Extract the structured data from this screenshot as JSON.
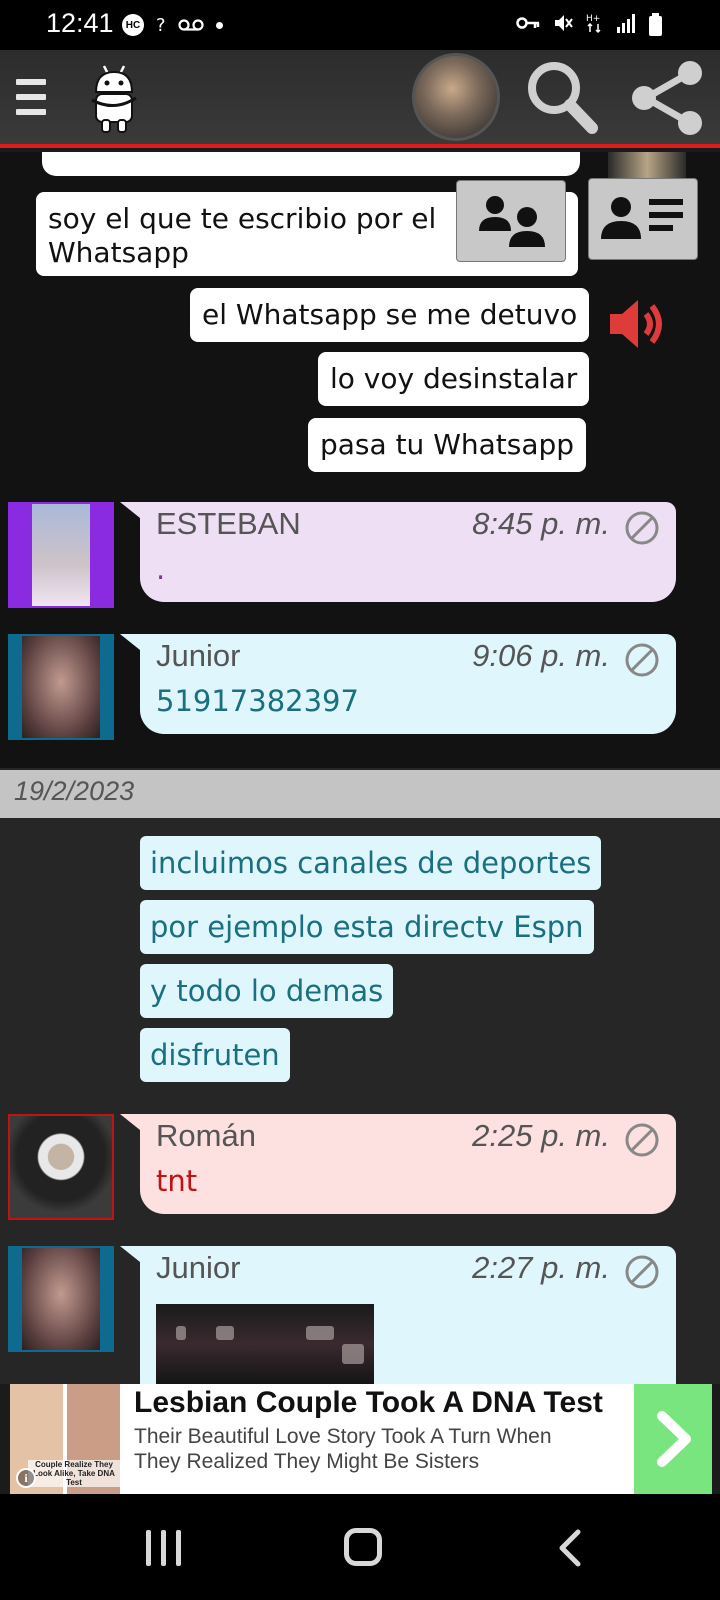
{
  "status_bar": {
    "time": "12:41",
    "hc_badge": "HC",
    "network_small": "?",
    "voicemail_icon": "voicemail-icon",
    "dot_icon": "notification-dot-icon",
    "right_icons": [
      "key-icon",
      "mute-vibrate-icon",
      "data-hplus-icon",
      "signal-icon",
      "battery-icon"
    ]
  },
  "app_bar": {
    "menu_icon": "hamburger-menu-icon",
    "logo_icon": "android-mascot-logo",
    "avatar": "user-avatar",
    "search_icon": "search-icon",
    "share_icon": "share-icon",
    "accent_color": "#e01b1b"
  },
  "chat_top": {
    "message_1": "soy el que te escribio por el Whatsapp",
    "message_2": "el Whatsapp se me detuvo",
    "message_3": "lo voy desinstalar",
    "message_4": "pasa tu Whatsapp",
    "group_button_icon": "group-users-icon",
    "contact_card_icon": "contact-card-icon",
    "speaker_icon": "speaker-volume-icon"
  },
  "messages": [
    {
      "name": "ESTEBAN",
      "time": "8:45 p. m.",
      "text": ".",
      "bg": "#eedff5",
      "text_color": "#7a3a9a",
      "avatar_border": "#8a2be2"
    },
    {
      "name": "Junior",
      "time": "9:06 p. m.",
      "text": "51917382397",
      "bg": "#dff7fc",
      "text_color": "#1a6f80",
      "avatar_border": "#0e6a8e"
    },
    {
      "name": "Román",
      "time": "2:25 p. m.",
      "text": "tnt",
      "bg": "#fde0e0",
      "text_color": "#c01414",
      "avatar_border": "#c01414"
    },
    {
      "name": "Junior",
      "time": "2:27 p. m.",
      "text": "",
      "bg": "#dff7fc",
      "text_color": "#1a6f80",
      "avatar_border": "#0e6a8e"
    }
  ],
  "date_separator": "19/2/2023",
  "continued_messages": [
    "incluimos canales de deportes",
    "por ejemplo esta directv Espn",
    "y todo lo demas",
    "disfruten"
  ],
  "ad": {
    "title": "Lesbian Couple Took A DNA Test",
    "description": "Their Beautiful Love Story Took A Turn When They Realized They Might Be Sisters",
    "image_caption": "Couple Realize They Look Alike, Take DNA Test",
    "info_icon": "info-icon",
    "cta_icon": "chevron-right-icon",
    "cta_color": "#79e57e"
  },
  "nav_bar": {
    "recent_icon": "recent-apps-icon",
    "home_icon": "home-icon",
    "back_icon": "back-icon"
  }
}
